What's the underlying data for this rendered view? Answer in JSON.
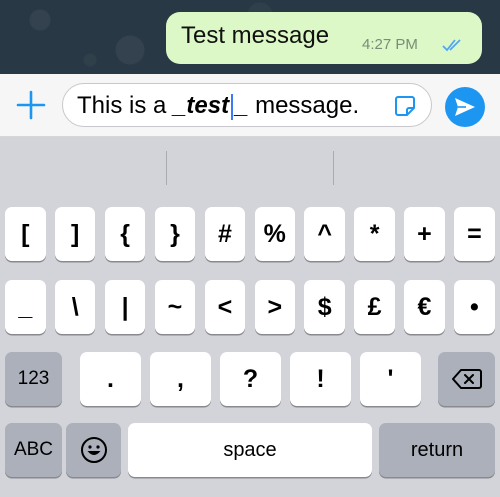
{
  "chat": {
    "message": "Test message",
    "time": "4:27 PM"
  },
  "composer": {
    "text_before": "This is a ",
    "text_italic": "_test_",
    "text_after": " message."
  },
  "keyboard": {
    "row1": [
      "[",
      "]",
      "{",
      "}",
      "#",
      "%",
      "^",
      "*",
      "+",
      "="
    ],
    "row2": [
      "_",
      "\\",
      "|",
      "~",
      "<",
      ">",
      "$",
      "£",
      "€",
      "•"
    ],
    "row3": [
      ".",
      ",",
      "?",
      "!",
      "'"
    ],
    "numbers_key": "123",
    "abc_key": "ABC",
    "space_key": "space",
    "return_key": "return"
  },
  "colors": {
    "bubble": "#dcf8c6",
    "send_button": "#1d96f2",
    "accent_blue": "#1d96f2",
    "keyboard_bg": "#d2d4da"
  },
  "icons": {
    "plus": "plus-icon",
    "sticker": "sticker-icon",
    "send": "send-arrow-icon",
    "read_ticks": "double-check-icon",
    "emoji": "emoji-icon",
    "delete": "backspace-icon"
  }
}
